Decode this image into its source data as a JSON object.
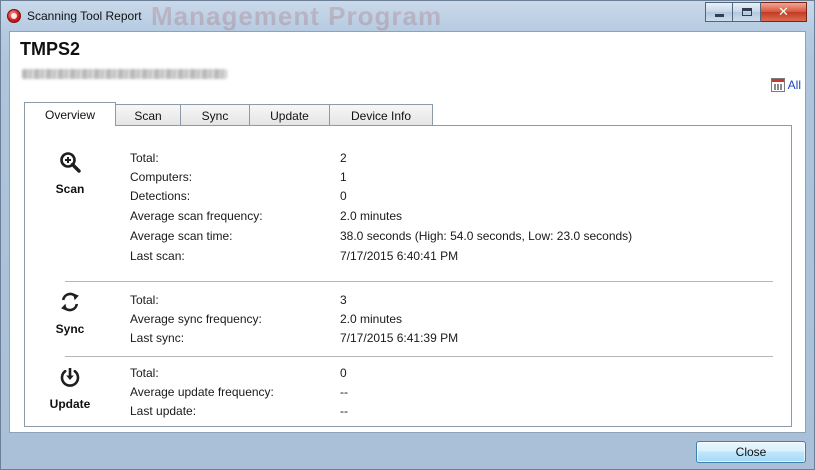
{
  "window": {
    "title": "Scanning Tool Report",
    "background_title": "Management Program",
    "accent_color": "#c63a2e"
  },
  "header": {
    "device_name": "TMPS2",
    "device_id": "0E1-1000-1000-000000777778",
    "all_link_label": "All",
    "all_link_icon": "calendar-icon"
  },
  "tabs": [
    {
      "label": "Overview",
      "active": true
    },
    {
      "label": "Scan",
      "active": false
    },
    {
      "label": "Sync",
      "active": false
    },
    {
      "label": "Update",
      "active": false
    },
    {
      "label": "Device Info",
      "active": false
    }
  ],
  "overview": {
    "scan": {
      "label": "Scan",
      "icon": "magnifier-plus-icon",
      "rows": [
        {
          "label": "Total:",
          "value": "2"
        },
        {
          "label": "Computers:",
          "value": "1"
        },
        {
          "label": "Detections:",
          "value": "0"
        },
        {
          "label": "Average scan frequency:",
          "value": "2.0 minutes"
        },
        {
          "label": "Average scan time:",
          "value": "38.0 seconds (High: 54.0 seconds, Low: 23.0 seconds)"
        },
        {
          "label": "Last scan:",
          "value": "7/17/2015 6:40:41 PM"
        }
      ]
    },
    "sync": {
      "label": "Sync",
      "icon": "sync-arrows-icon",
      "rows": [
        {
          "label": "Total:",
          "value": "3"
        },
        {
          "label": "Average sync frequency:",
          "value": "2.0 minutes"
        },
        {
          "label": "Last sync:",
          "value": "7/17/2015 6:41:39 PM"
        }
      ]
    },
    "update": {
      "label": "Update",
      "icon": "download-circle-icon",
      "rows": [
        {
          "label": "Total:",
          "value": "0"
        },
        {
          "label": "Average update frequency:",
          "value": "--"
        },
        {
          "label": "Last update:",
          "value": "--"
        }
      ]
    }
  },
  "footer": {
    "close_label": "Close"
  }
}
